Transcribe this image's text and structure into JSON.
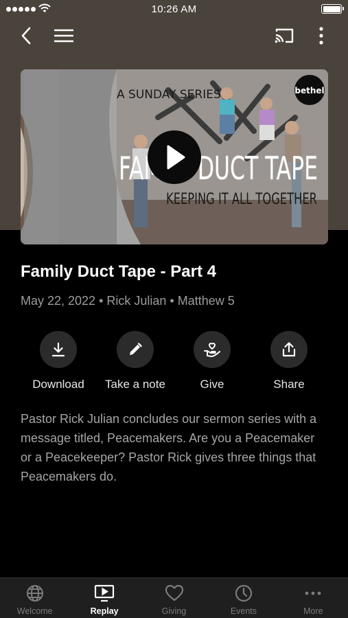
{
  "status_bar": {
    "time": "10:26 AM"
  },
  "video": {
    "overlay_series": "A SUNDAY SERIES",
    "overlay_title": "FAMILY DUCT TAPE",
    "overlay_subtitle": "KEEPING IT ALL TOGETHER",
    "logo_text": "bethel"
  },
  "sermon": {
    "title": "Family Duct Tape - Part 4",
    "meta": "May 22, 2022 • Rick Julian • Matthew 5",
    "description": "Pastor Rick Julian concludes our sermon series with a message titled, Peacemakers. Are you a Peacemaker or a Peacekeeper? Pastor Rick gives three things that Peacemakers do."
  },
  "actions": [
    {
      "label": "Download",
      "icon": "download-icon"
    },
    {
      "label": "Take a note",
      "icon": "pencil-icon"
    },
    {
      "label": "Give",
      "icon": "hand-heart-icon"
    },
    {
      "label": "Share",
      "icon": "share-icon"
    }
  ],
  "tabs": [
    {
      "label": "Welcome",
      "icon": "globe-icon",
      "active": false
    },
    {
      "label": "Replay",
      "icon": "tv-play-icon",
      "active": true
    },
    {
      "label": "Giving",
      "icon": "heart-icon",
      "active": false
    },
    {
      "label": "Events",
      "icon": "clock-icon",
      "active": false
    },
    {
      "label": "More",
      "icon": "ellipsis-icon",
      "active": false
    }
  ]
}
